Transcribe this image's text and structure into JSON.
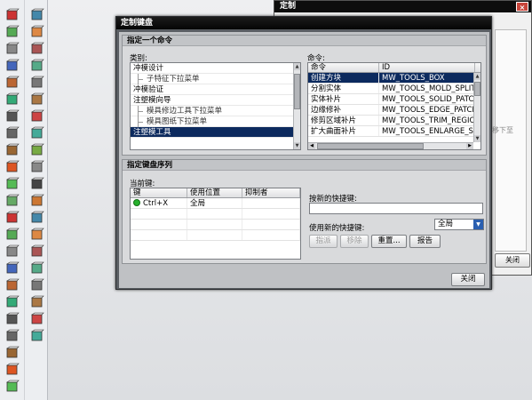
{
  "main_dialog": {
    "title": "定制键盘",
    "command_group": {
      "header": "指定一个命令",
      "category_label": "类别:",
      "categories": [
        {
          "label": "冲模设计",
          "indent": false,
          "selected": false
        },
        {
          "label": "子特征下拉菜单",
          "indent": true,
          "selected": false
        },
        {
          "label": "冲模验证",
          "indent": false,
          "selected": false
        },
        {
          "label": "注塑模向导",
          "indent": false,
          "selected": false
        },
        {
          "label": "模具修边工具下拉菜单",
          "indent": true,
          "selected": false
        },
        {
          "label": "模具图纸下拉菜单",
          "indent": true,
          "selected": false
        },
        {
          "label": "注塑模工具",
          "indent": false,
          "selected": true
        }
      ],
      "command_label": "命令:",
      "command_columns": [
        "命令",
        "ID"
      ],
      "commands": [
        {
          "name": "创建方块",
          "id": "MW_TOOLS_BOX",
          "selected": true
        },
        {
          "name": "分割实体",
          "id": "MW_TOOLS_MOLD_SPLIT",
          "selected": false
        },
        {
          "name": "实体补片",
          "id": "MW_TOOLS_SOLID_PATCH",
          "selected": false
        },
        {
          "name": "边缘修补",
          "id": "MW_TOOLS_EDGE_PATCH",
          "selected": false
        },
        {
          "name": "修剪区域补片",
          "id": "MW_TOOLS_TRIM_REGION_",
          "selected": false
        },
        {
          "name": "扩大曲面补片",
          "id": "MW_TOOLS_ENLARGE_SUR",
          "selected": false
        }
      ]
    },
    "key_group": {
      "header": "指定键盘序列",
      "current_keys_label": "当前键:",
      "key_columns": [
        "键",
        "使用位置",
        "抑制者"
      ],
      "keys": [
        {
          "key": "Ctrl+X",
          "location": "全局",
          "suppressor": ""
        }
      ],
      "new_shortcut_label": "按新的快捷键:",
      "new_shortcut_value": "",
      "use_shortcut_label": "使用新的快捷键:",
      "scope_value": "全局",
      "assign_button": "指派",
      "remove_button": "移除",
      "reset_button": "重置...",
      "report_button": "报告"
    },
    "close_button": "关闭"
  },
  "back_dialog": {
    "title": "定制",
    "close_x": "×",
    "hint": "移下至",
    "close_button": "关闭"
  },
  "colors": {
    "title_bar": "#050505",
    "selection": "#0c2a5e",
    "status_dot": "#27b12d",
    "dropdown_accent": "#2a5fb0"
  }
}
